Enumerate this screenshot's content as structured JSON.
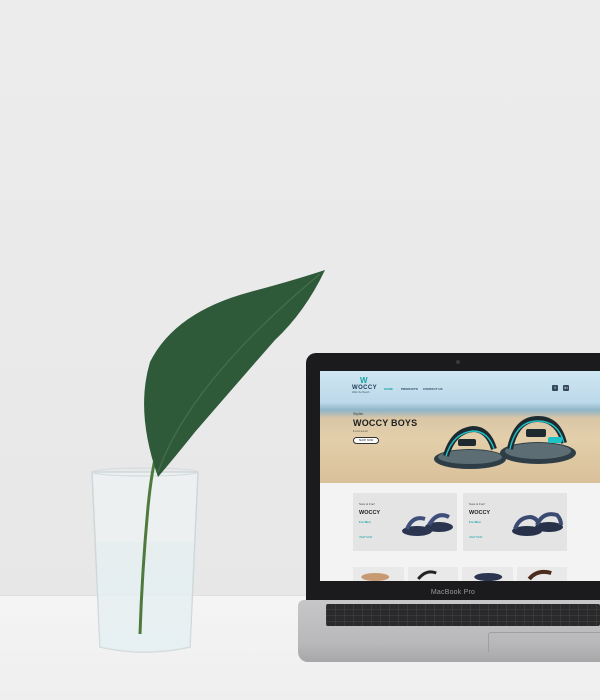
{
  "laptop": {
    "model_label": "MacBook Pro"
  },
  "website": {
    "logo": {
      "mark": "W",
      "name": "WOCCY",
      "tagline": "Walk the Beach"
    },
    "nav": {
      "items": [
        "HOME",
        "PRODUCTS",
        "CONTACT US"
      ],
      "active": "HOME"
    },
    "social": {
      "facebook": "f",
      "instagram": "in"
    },
    "hero": {
      "eyebrow": "Stylish",
      "title": "WOCCY BOYS",
      "subtitle": "Footwear",
      "button": "SHOP NOW"
    },
    "cards": [
      {
        "eyebrow": "Sure & Fun!",
        "brand": "WOCCY",
        "sub": "For Men",
        "link": "VIEW NOW"
      },
      {
        "eyebrow": "Sure & Fun!",
        "brand": "WOCCY",
        "sub": "For Men",
        "link": "VIEW NOW"
      }
    ]
  },
  "colors": {
    "accent": "#16a3a5",
    "laptop_bezel": "#1b1b1d",
    "laptop_body": "#c7c7c9",
    "leaf": "#2f5a3a",
    "background": "#ececec"
  },
  "icons": [
    "leaf-icon",
    "glass-icon",
    "facebook-icon",
    "instagram-icon",
    "sandal-icon"
  ]
}
